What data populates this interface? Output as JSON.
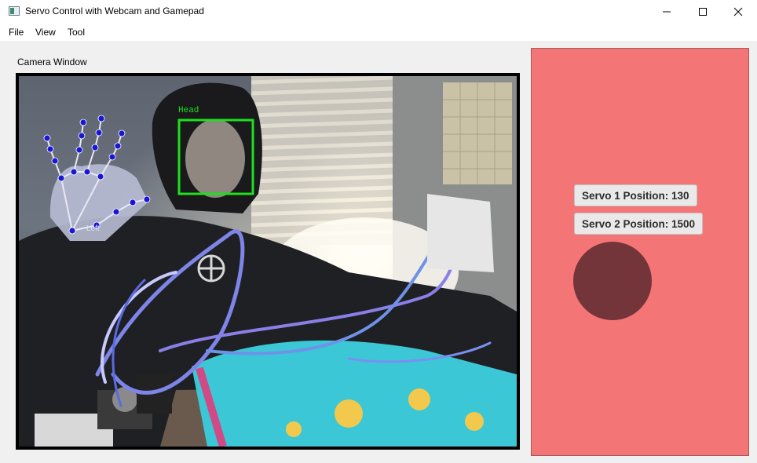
{
  "window": {
    "title": "Servo Control with Webcam and Gamepad",
    "controls": [
      "minimize-icon",
      "maximize-icon",
      "close-icon"
    ]
  },
  "menu": {
    "items": [
      {
        "label": "File"
      },
      {
        "label": "View"
      },
      {
        "label": "Tool"
      }
    ]
  },
  "camera": {
    "label": "Camera Window",
    "head_label": "Head",
    "hand_label": "Left",
    "head_box_color": "#1ee01e",
    "landmark_color": "#1a16d6"
  },
  "servo": {
    "servo1_text": "Servo 1 Position: 130",
    "servo2_text": "Servo 2 Position: 1500",
    "panel_color": "#f47575",
    "indicator_color": "#73343a"
  }
}
